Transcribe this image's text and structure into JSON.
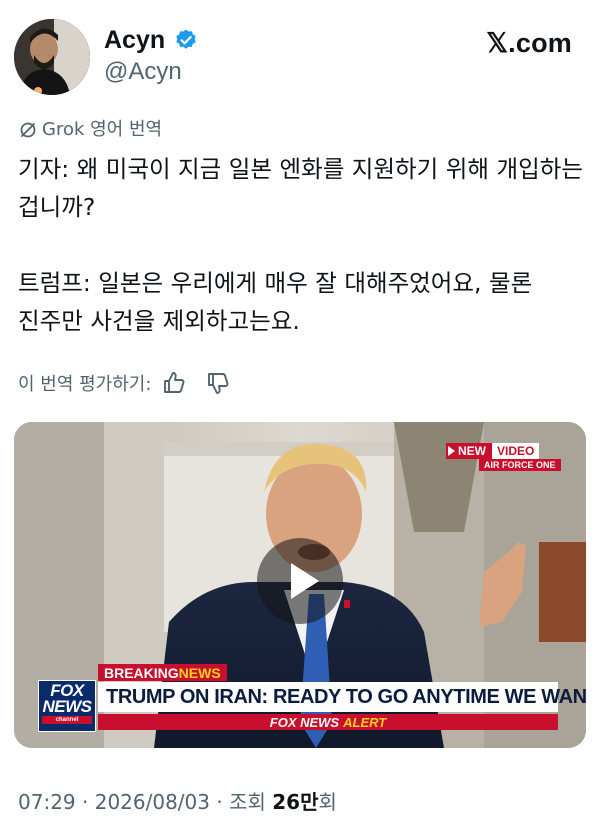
{
  "author": {
    "display_name": "Acyn",
    "handle": "@Acyn",
    "verified_color": "#1d9bf0"
  },
  "brand": {
    "logo_text": "𝕏.com"
  },
  "translation": {
    "label": "Grok 영어 번역",
    "icon": "slashed-circle-icon"
  },
  "tweet": {
    "text": "기자: 왜 미국이 지금 일본 엔화를 지원하기 위해 개입하는 겁니까?\n\n트럼프: 일본은 우리에게 매우 잘 대해주었어요, 물론 진주만 사건을 제외하고는요."
  },
  "rating": {
    "label": "이 번역 평가하기:",
    "like_icon": "thumbs-up-icon",
    "dislike_icon": "thumbs-down-icon"
  },
  "video": {
    "badge_new": "NEW",
    "badge_video": "VIDEO",
    "badge_sub": "AIR FORCE ONE",
    "breaking_a": "BREAKING ",
    "breaking_b": "NEWS",
    "headline": "TRUMP ON IRAN: READY TO GO ANYTIME WE WANT",
    "alert_a": "FOX NEWS",
    "alert_b": "ALERT",
    "fox_logo_word": "FOX NEWS",
    "fox_logo_sub": "channel",
    "play_icon": "play-icon",
    "accent_red": "#c8102e",
    "accent_yellow": "#ffd21c",
    "navy": "#0b2a6b"
  },
  "meta": {
    "time": "07:29",
    "sep1": " · ",
    "date": "2026/08/03",
    "sep2": " · ",
    "views_label": "조회 ",
    "views_count": "26만",
    "views_suffix": "회"
  }
}
